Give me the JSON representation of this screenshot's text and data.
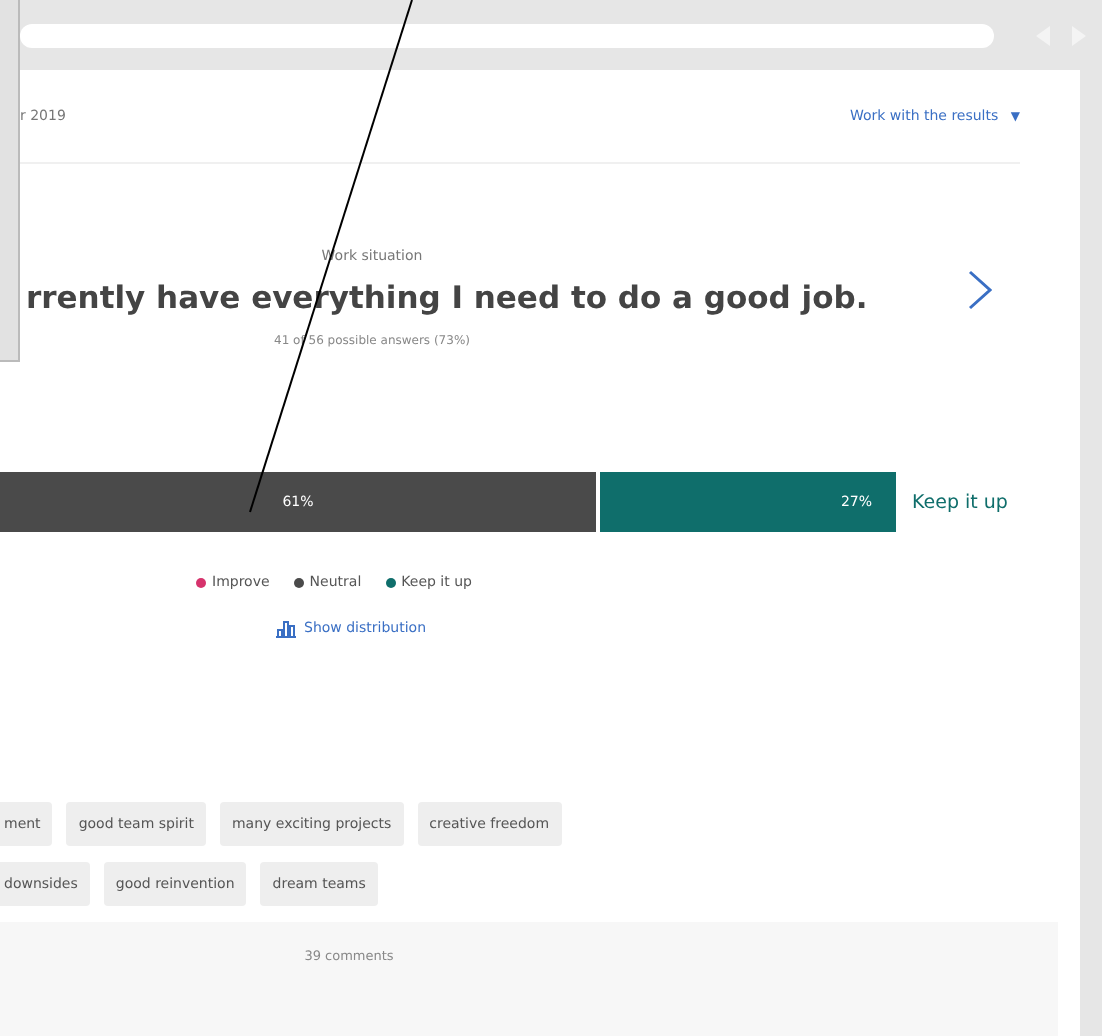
{
  "header": {
    "date": "r 2019",
    "menu_label": "Work with the results",
    "menu_caret": "▼"
  },
  "question": {
    "category": "Work situation",
    "text": "rrently have everything I need to do a good job.",
    "answers": "41 of 56 possible answers (73%)"
  },
  "result_bar": {
    "segments": [
      {
        "label": "61%",
        "color": "#4a4a4a",
        "kind": "neutral"
      },
      {
        "label": "27%",
        "color": "#0f6e6b",
        "kind": "keep"
      }
    ],
    "verdict": "Keep it up"
  },
  "legend": [
    {
      "label": "Improve",
      "color": "#d6336c"
    },
    {
      "label": "Neutral",
      "color": "#4a4a4a"
    },
    {
      "label": "Keep it up",
      "color": "#0f6e6b"
    }
  ],
  "distribution_link": "Show distribution",
  "tag_rows": [
    [
      "ment",
      "good team spirit",
      "many exciting projects",
      "creative freedom"
    ],
    [
      "downsides",
      "good reinvention",
      "dream teams"
    ]
  ],
  "comments": "39 comments"
}
